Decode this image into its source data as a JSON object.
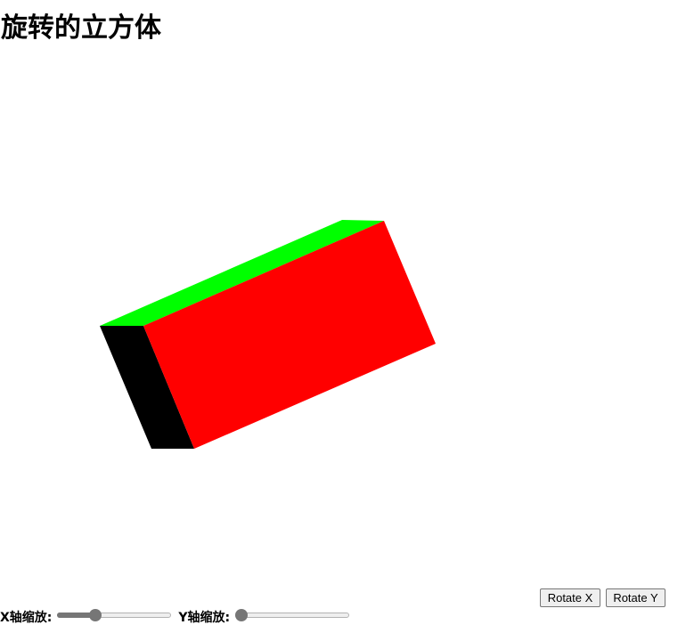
{
  "page": {
    "title": "旋转的立方体"
  },
  "cube": {
    "face_colors": {
      "front": "#ff0000",
      "top": "#00ff00",
      "side": "#000000"
    }
  },
  "buttons": {
    "rotate_x": "Rotate X",
    "rotate_y": "Rotate Y"
  },
  "controls": {
    "x_scale_label": "X轴缩放:",
    "y_scale_label": "Y轴缩放:",
    "x_scale_fraction": 0.31,
    "y_scale_fraction": 0.0
  }
}
